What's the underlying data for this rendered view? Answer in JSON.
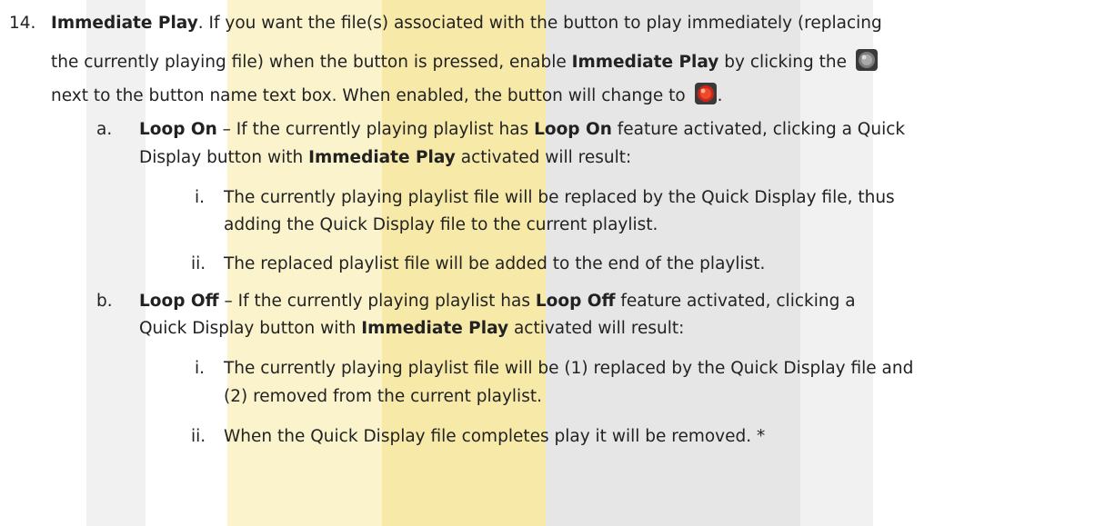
{
  "watermark_colors": {
    "yellow_light": "#fbf3cc",
    "yellow": "#f7e9a8",
    "gray_light": "#f1f1f1",
    "gray": "#e6e6e6"
  },
  "item14": {
    "number": "14.",
    "term": "Immediate Play",
    "line1_text": ". If you want the file(s) associated with the button to play immediately (replacing",
    "line2_text_a": "the currently playing file) when the button is pressed, enable ",
    "line2_term": "Immediate Play",
    "line2_text_b": " by clicking the",
    "disabled_icon": "gray-round-toggle-icon",
    "line3_text": "next to the button name text box. When enabled, the button will change to",
    "enabled_icon": "red-round-toggle-icon",
    "line3_end": "."
  },
  "sub_a": {
    "marker": "a.",
    "term": "Loop On",
    "line1_text_a": " – If the currently playing playlist has ",
    "line1_term": "Loop On",
    "line1_text_b": " feature activated, clicking a Quick",
    "line2_text_a": "Display button with ",
    "line2_term": "Immediate Play",
    "line2_text_b": " activated will result:",
    "items": [
      {
        "marker": "i.",
        "line1": "The currently playing playlist file will be replaced by the Quick Display file, thus",
        "line2": "adding the Quick Display file to the current playlist."
      },
      {
        "marker": "ii.",
        "line1": "The replaced playlist file will be added to the end of the playlist."
      }
    ]
  },
  "sub_b": {
    "marker": "b.",
    "term": "Loop Off",
    "line1_text_a": " – If the currently playing playlist has ",
    "line1_term": "Loop Off",
    "line1_text_b": " feature activated, clicking a",
    "line2_text_a": "Quick Display button with ",
    "line2_term": "Immediate Play",
    "line2_text_b": " activated will result:",
    "items": [
      {
        "marker": "i.",
        "line1": "The currently playing playlist file will be (1) replaced by the Quick Display file and",
        "line2": "(2) removed from the current playlist."
      },
      {
        "marker": "ii.",
        "line1": "When the Quick Display file completes play it will be removed. *"
      }
    ]
  }
}
